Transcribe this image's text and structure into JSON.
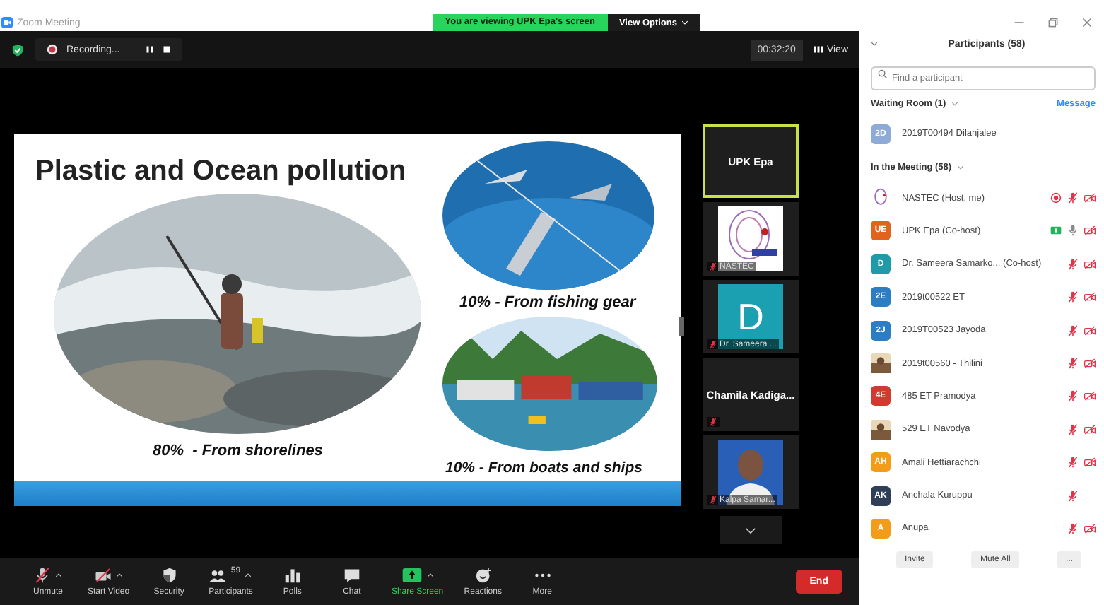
{
  "window": {
    "title": "Zoom Meeting"
  },
  "banner": {
    "text": "You are viewing UPK Epa's screen",
    "options": "View Options"
  },
  "recording": {
    "label": "Recording..."
  },
  "timer": "00:32:20",
  "view": "View",
  "slide": {
    "title": "Plastic and Ocean pollution",
    "captions": [
      "10% - From fishing gear",
      "80%  - From shorelines",
      "10% - From boats and ships"
    ]
  },
  "thumbnails": [
    {
      "kind": "name",
      "name": "UPK Epa",
      "selected": true,
      "muted": false
    },
    {
      "kind": "logo",
      "name": "NASTEC",
      "selected": false,
      "muted": true
    },
    {
      "kind": "avatar",
      "initial": "D",
      "name": "Dr. Sameera ...",
      "selected": false,
      "muted": true
    },
    {
      "kind": "name",
      "name": "Chamila  Kadiga...",
      "selected": false,
      "muted": true
    },
    {
      "name": "Kalpa Samar...",
      "selected": false,
      "muted": true
    }
  ],
  "toolbar": [
    {
      "kind": "mic",
      "label": "Unmute",
      "caret": true
    },
    {
      "kind": "video",
      "label": "Start Video",
      "caret": true
    },
    {
      "kind": "shield",
      "label": "Security",
      "caret": false
    },
    {
      "kind": "people",
      "label": "Participants",
      "count": "59",
      "caret": true
    },
    {
      "kind": "polls",
      "label": "Polls",
      "caret": false
    },
    {
      "kind": "chat",
      "label": "Chat",
      "caret": false
    },
    {
      "kind": "share",
      "label": "Share Screen",
      "caret": true
    },
    {
      "kind": "reactions",
      "label": "Reactions",
      "caret": false
    },
    {
      "kind": "more",
      "label": "More",
      "caret": false
    }
  ],
  "end": "End",
  "participants": {
    "title": "Participants (58)",
    "search_placeholder": "Find a participant",
    "waiting_title": "Waiting Room (1)",
    "message": "Message",
    "waiting": [
      {
        "name": "2019T00494 Dilanjalee",
        "avatar": {
          "kind": "initials",
          "initials": "2D",
          "color": "#8eaad6"
        }
      }
    ],
    "meeting_title": "In the Meeting (58)",
    "people": [
      {
        "name": "NASTEC (Host, me)",
        "avatar": {
          "kind": "logo"
        },
        "recording": true,
        "sharing": false,
        "muted": true,
        "video_off": true
      },
      {
        "name": "UPK Epa (Co-host)",
        "avatar": {
          "kind": "initials",
          "initials": "UE",
          "color": "#e0641e"
        },
        "recording": false,
        "sharing": true,
        "muted": false,
        "video_off": true
      },
      {
        "name": "Dr. Sameera Samarko... (Co-host)",
        "avatar": {
          "kind": "initials",
          "initials": "D",
          "color": "#1f9aa8"
        },
        "recording": false,
        "sharing": false,
        "muted": true,
        "video_off": true
      },
      {
        "name": "2019t00522 ET",
        "avatar": {
          "kind": "initials",
          "initials": "2E",
          "color": "#2d7dc4"
        },
        "recording": false,
        "sharing": false,
        "muted": true,
        "video_off": true
      },
      {
        "name": "2019T00523 Jayoda",
        "avatar": {
          "kind": "initials",
          "initials": "2J",
          "color": "#2d7dc4"
        },
        "recording": false,
        "sharing": false,
        "muted": true,
        "video_off": true
      },
      {
        "name": "2019t00560 - Thilini",
        "recording": false,
        "sharing": false,
        "muted": true,
        "video_off": true
      },
      {
        "name": "485 ET Pramodya",
        "avatar": {
          "kind": "initials",
          "initials": "4E",
          "color": "#d13a2e"
        },
        "recording": false,
        "sharing": false,
        "muted": true,
        "video_off": true
      },
      {
        "name": "529 ET Navodya",
        "recording": false,
        "sharing": false,
        "muted": true,
        "video_off": true
      },
      {
        "name": "Amali Hettiarachchi",
        "avatar": {
          "kind": "initials",
          "initials": "AH",
          "color": "#f39c1a"
        },
        "recording": false,
        "sharing": false,
        "muted": true,
        "video_off": true
      },
      {
        "name": "Anchala Kuruppu",
        "avatar": {
          "kind": "initials",
          "initials": "AK",
          "color": "#2f3f57"
        },
        "recording": false,
        "sharing": false,
        "muted": true,
        "video_off": false
      },
      {
        "name": "Anupa",
        "avatar": {
          "kind": "initials",
          "initials": "A",
          "color": "#f39c1a"
        },
        "recording": false,
        "sharing": false,
        "muted": true,
        "video_off": true
      }
    ],
    "buttons": [
      "Invite",
      "Mute All",
      "..."
    ]
  }
}
